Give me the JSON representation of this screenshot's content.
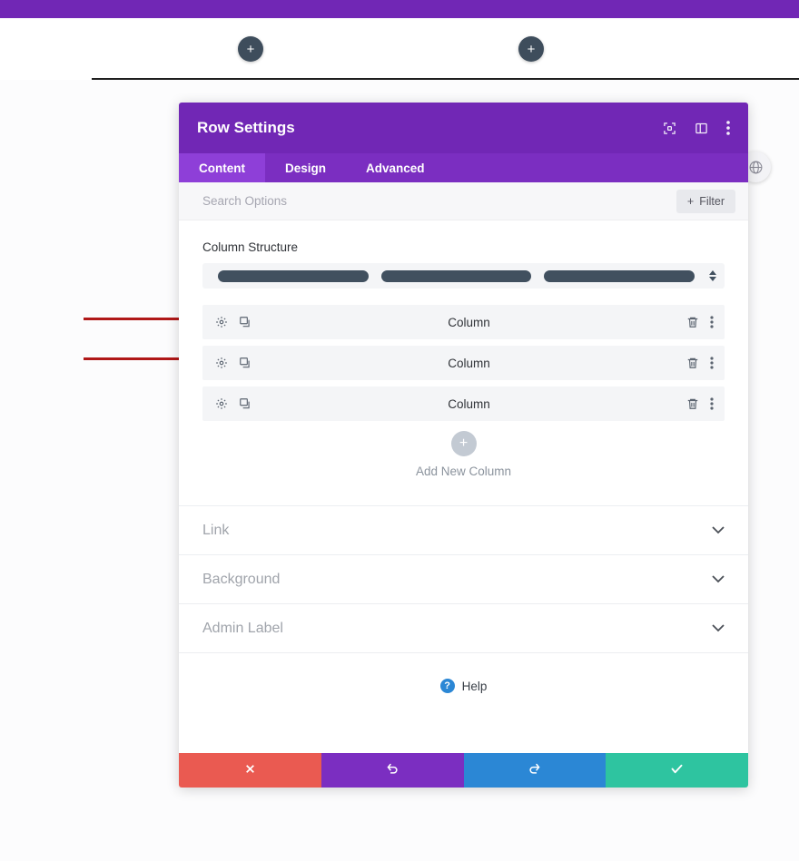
{
  "page": {
    "top_bar_color": "#7127b5",
    "add_row_buttons": [
      {
        "name": "add-row-left",
        "glyph": "+"
      },
      {
        "name": "add-row-right",
        "glyph": "+"
      }
    ],
    "globe_badge_icon": "globe-icon"
  },
  "annotations": {
    "arrow_color": "#b01818",
    "arrows": [
      {
        "name": "annotation-arrow-column-1"
      },
      {
        "name": "annotation-arrow-column-2"
      }
    ]
  },
  "modal": {
    "title": "Row Settings",
    "header_color": "#7127b5",
    "header_icons": [
      {
        "name": "focus-target-icon",
        "label": "focus-target-icon"
      },
      {
        "name": "layout-panel-icon",
        "label": "layout-panel-icon"
      },
      {
        "name": "kebab-menu-icon",
        "label": "kebab-menu-icon"
      }
    ],
    "tabs": [
      {
        "label": "Content",
        "active": true
      },
      {
        "label": "Design",
        "active": false
      },
      {
        "label": "Advanced",
        "active": false
      }
    ],
    "search": {
      "placeholder": "Search Options",
      "value": ""
    },
    "filter_button": {
      "label": "Filter",
      "icon": "plus-icon"
    },
    "column_structure": {
      "label": "Column Structure",
      "bars": 3,
      "spinner_icon": "updown-arrows-icon"
    },
    "columns": [
      {
        "name": "Column",
        "settings_icon": "gear-icon",
        "duplicate_icon": "duplicate-icon",
        "delete_icon": "trash-icon",
        "menu_icon": "kebab-menu-icon"
      },
      {
        "name": "Column",
        "settings_icon": "gear-icon",
        "duplicate_icon": "duplicate-icon",
        "delete_icon": "trash-icon",
        "menu_icon": "kebab-menu-icon"
      },
      {
        "name": "Column",
        "settings_icon": "gear-icon",
        "duplicate_icon": "duplicate-icon",
        "delete_icon": "trash-icon",
        "menu_icon": "kebab-menu-icon"
      }
    ],
    "add_new_column": {
      "label": "Add New Column",
      "icon": "plus-icon"
    },
    "accordion": [
      {
        "label": "Link",
        "chevron": "chevron-down-icon"
      },
      {
        "label": "Background",
        "chevron": "chevron-down-icon"
      },
      {
        "label": "Admin Label",
        "chevron": "chevron-down-icon"
      }
    ],
    "help": {
      "label": "Help",
      "badge": "?",
      "badge_color": "#2b87d5"
    },
    "footer_buttons": [
      {
        "name": "cancel-button",
        "icon": "close-x-icon",
        "color": "#ea5a51"
      },
      {
        "name": "undo-button",
        "icon": "undo-icon",
        "color": "#7b2ec1"
      },
      {
        "name": "redo-button",
        "icon": "redo-icon",
        "color": "#2b87d5"
      },
      {
        "name": "save-button",
        "icon": "checkmark-icon",
        "color": "#2ec4a0"
      }
    ]
  }
}
